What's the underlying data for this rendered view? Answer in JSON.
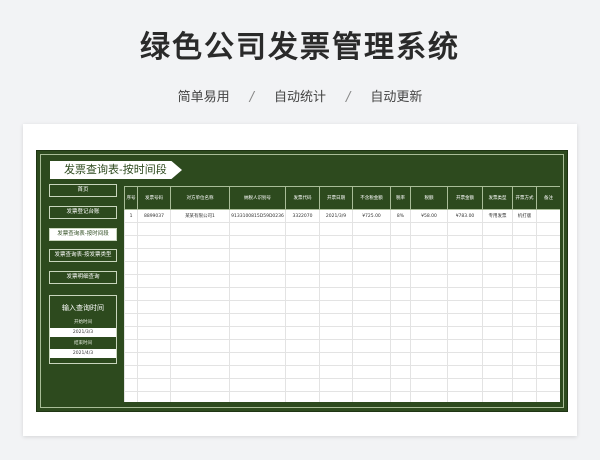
{
  "header": {
    "title": "绿色公司发票管理系统",
    "features": [
      "简单易用",
      "自动统计",
      "自动更新"
    ],
    "separator": "/"
  },
  "sheet": {
    "tab_title": "发票查询表-按时间段",
    "nav": [
      {
        "label": "首页",
        "active": false
      },
      {
        "label": "发票登记台账",
        "active": false
      },
      {
        "label": "发票查询表-按时间段",
        "active": true
      },
      {
        "label": "发票查询表-按发票类型",
        "active": false
      },
      {
        "label": "发票明细查询",
        "active": false
      }
    ],
    "query": {
      "title": "输入查询时间",
      "start_label": "开始时间",
      "start_value": "2021/3/3",
      "end_label": "结束时间",
      "end_value": "2021/4/3"
    },
    "table": {
      "columns": [
        "序号",
        "发票号码",
        "对方单位名称",
        "纳税人识别号",
        "发票代码",
        "开票日期",
        "不含税金额",
        "税率",
        "税额",
        "开票金额",
        "发票类型",
        "开票方式",
        "备注"
      ],
      "rows": [
        [
          "1",
          "8899037",
          "某某有限公司1",
          "9133100815D59D0236",
          "3322070",
          "2021/3/9",
          "¥725.00",
          "8%",
          "¥58.00",
          "¥783.00",
          "专用发票",
          "机打版",
          ""
        ]
      ],
      "empty_rows": 15
    }
  },
  "colors": {
    "sheet_green": "#2d4a1e",
    "border_light": "#a9bd98"
  }
}
